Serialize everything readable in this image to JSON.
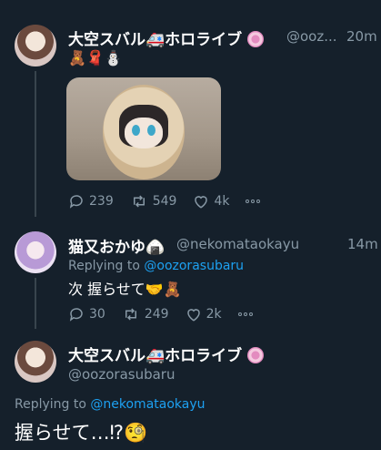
{
  "tweets": [
    {
      "display_name": "大空スバル🚑ホロライブ",
      "handle": "@ooz...",
      "time": "20m",
      "text": "🧸🧣⛄",
      "actions": {
        "replies": "239",
        "retweets": "549",
        "likes": "4k"
      }
    },
    {
      "display_name": "猫又おかゆ🍙",
      "handle": "@nekomataokayu",
      "time": "14m",
      "replying_prefix": "Replying to ",
      "replying_handle": "@oozorasubaru",
      "text": "次 握らせて🤝🧸",
      "actions": {
        "replies": "30",
        "retweets": "249",
        "likes": "2k"
      }
    },
    {
      "display_name": "大空スバル🚑ホロライブ",
      "handle": "@oozorasubaru",
      "replying_prefix": "Replying to ",
      "replying_handle": "@nekomataokayu",
      "text": "握らせて…⁉🧐"
    }
  ],
  "colors": {
    "background": "#15202b",
    "muted": "#8899a6",
    "link": "#1da1f2",
    "thread_line": "#38444d"
  },
  "icons": [
    "reply-icon",
    "retweet-icon",
    "like-icon",
    "more-icon",
    "verified-badge-icon"
  ]
}
